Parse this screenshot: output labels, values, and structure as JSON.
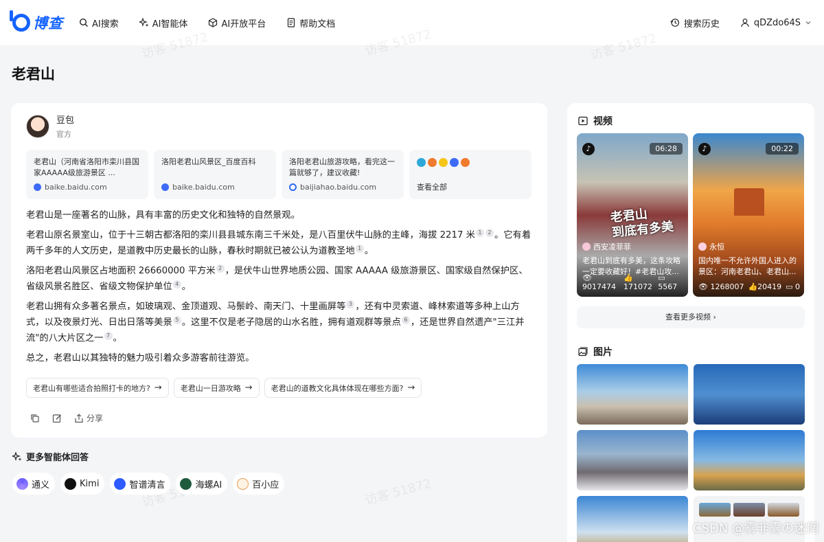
{
  "header": {
    "logo_text": "博查",
    "nav": [
      {
        "label": "AI搜索",
        "icon": "search-icon"
      },
      {
        "label": "AI智能体",
        "icon": "sparkle-icon"
      },
      {
        "label": "AI开放平台",
        "icon": "cube-icon"
      },
      {
        "label": "帮助文档",
        "icon": "document-icon"
      }
    ],
    "history_label": "搜索历史",
    "username": "qDZdo64S"
  },
  "watermark": "访客 51872",
  "page_title": "老君山",
  "answer": {
    "author_name": "豆包",
    "author_role": "官方",
    "sources": [
      {
        "title": "老君山（河南省洛阳市栾川县国家AAAAA级旅游景区 ...",
        "domain": "baike.baidu.com"
      },
      {
        "title": "洛阳老君山风景区_百度百科",
        "domain": "baike.baidu.com"
      },
      {
        "title": "洛阳老君山旅游攻略，看完这一篇就够了，建议收藏!",
        "domain": "baijiahao.baidu.com"
      }
    ],
    "view_all": "查看全部",
    "paragraphs": {
      "p1": "老君山是一座著名的山脉，具有丰富的历史文化和独特的自然景观。",
      "p2a": "老君山原名景室山，位于十三朝古都洛阳的栾川县县城东南三千米处，是八百里伏牛山脉的主峰，海拔 2217 米",
      "p2b": "。它有着两千多年的人文历史，是道教中历史最长的山脉，春秋时期就已被公认为道教圣地",
      "p2c": "。",
      "p3a": "洛阳老君山风景区占地面积 26660000 平方米",
      "p3b": "，是伏牛山世界地质公园、国家 AAAAA 级旅游景区、国家级自然保护区、省级风景名胜区、省级文物保护单位",
      "p3c": "。",
      "p4a": "老君山拥有众多著名景点，如玻璃观、金顶道观、马鬃岭、南天门、十里画屏等",
      "p4b": "，还有中灵索道、峰林索道等多种上山方式，以及夜景灯光、日出日落等美景",
      "p4c": "。这里不仅是老子隐居的山水名胜，拥有道观群等景点",
      "p4d": "，还是世界自然遗产\"三江并流\"的八大片区之一",
      "p4e": "。",
      "p5": "总之，老君山以其独特的魅力吸引着众多游客前往游览。"
    },
    "cites": {
      "c1": "1",
      "c2": "2",
      "c3": "1",
      "c4": "2",
      "c5": "4",
      "c6": "3",
      "c7": "5",
      "c8": "6",
      "c9": "7"
    },
    "followups": [
      "老君山有哪些适合拍照打卡的地方?",
      "老君山一日游攻略",
      "老君山的道教文化具体体现在哪些方面?"
    ],
    "share_label": "分享"
  },
  "more_agents": {
    "title": "更多智能体回答",
    "items": [
      "通义",
      "Kimi",
      "智谱清言",
      "海螺AI",
      "百小应"
    ]
  },
  "side": {
    "video_title": "视频",
    "videos": [
      {
        "duration": "06:28",
        "overlay": "老君山\n到底有多美",
        "author": "西安凌菲菲",
        "desc": "老君山到底有多美，这条攻略一定要收藏好！#老君山攻...",
        "views": "9017474",
        "likes": "171072",
        "comments": "5567"
      },
      {
        "duration": "00:22",
        "author": "永恒",
        "desc": "国内唯一不允许外国人进入的景区：河南老君山、老君山...",
        "views": "1268007",
        "likes": "20419",
        "comments": "0"
      }
    ],
    "more_videos": "查看更多视频",
    "image_title": "图片"
  },
  "csdn_mark": "CSDN @雾非雾の迷惘"
}
